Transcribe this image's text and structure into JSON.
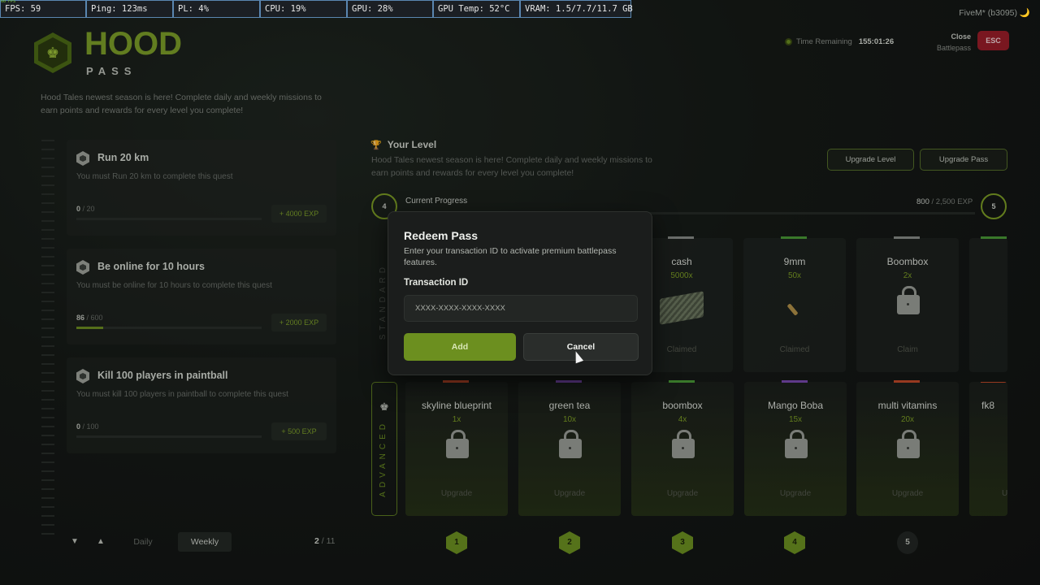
{
  "overlay": {
    "fps_tiny": "60 FPS",
    "cells": [
      "FPS: 59",
      "Ping: 123ms",
      "PL: 4%",
      "CPU: 19%",
      "GPU: 28%",
      "GPU Temp: 52°C",
      "VRAM: 1.5/7.7/11.7 GB"
    ],
    "client": "FiveM* (b3095) 🌙"
  },
  "header": {
    "title": "HOOD",
    "subtitle": "PASS",
    "intro": "Hood Tales newest season is here! Complete daily and weekly missions to earn points and rewards for every level you complete!",
    "time_label": "Time Remaining",
    "time_value": "155:01:26",
    "close_line1": "Close",
    "close_line2": "Battlepass",
    "esc": "ESC"
  },
  "quests": [
    {
      "title": "Run 20 km",
      "desc": "You must Run 20 km to complete this quest",
      "current": "0",
      "total": " / 20",
      "progress": 0,
      "exp": "+ 4000 EXP"
    },
    {
      "title": "Be online for 10 hours",
      "desc": "You must be online for 10 hours to complete this quest",
      "current": "86",
      "total": " / 600",
      "progress": 0.143,
      "exp": "+ 2000 EXP"
    },
    {
      "title": "Kill 100 players in paintball",
      "desc": "You must kill 100 players in paintball to complete this quest",
      "current": "0",
      "total": " / 100",
      "progress": 0,
      "exp": "+ 500 EXP"
    }
  ],
  "quest_nav": {
    "daily": "Daily",
    "weekly": "Weekly",
    "page_current": "2",
    "page_total": " / 11"
  },
  "level": {
    "title": "Your Level",
    "desc": "Hood Tales newest season is here! Complete daily and weekly missions to earn points and rewards for every level you complete!",
    "upgrade_level": "Upgrade Level",
    "upgrade_pass": "Upgrade Pass",
    "current_level": "4",
    "next_level": "5",
    "progress_label": "Current Progress",
    "exp_current": "800",
    "exp_total": " / 2,500 EXP",
    "progress_fraction": 0.32
  },
  "tracks": {
    "standard": "STANDARD",
    "advanced": "ADVANCED"
  },
  "standard_rewards": [
    {
      "name": "cash",
      "qty": "5000x",
      "status": "Claimed",
      "stripe": "#8a8d89",
      "icon": "cash-icon"
    },
    {
      "name": "9mm",
      "qty": "50x",
      "status": "Claimed",
      "stripe": "#4a9a36",
      "icon": "ammo-icon"
    },
    {
      "name": "Boombox",
      "qty": "2x",
      "status": "Claim",
      "stripe": "#8a8d89",
      "icon": "lock-icon"
    }
  ],
  "advanced_rewards": [
    {
      "name": "skyline blueprint",
      "qty": "1x",
      "status": "Upgrade",
      "stripe": "#c24a2a"
    },
    {
      "name": "green tea",
      "qty": "10x",
      "status": "Upgrade",
      "stripe": "#7a4ab0"
    },
    {
      "name": "boombox",
      "qty": "4x",
      "status": "Upgrade",
      "stripe": "#4a9a36"
    },
    {
      "name": "Mango Boba",
      "qty": "15x",
      "status": "Upgrade",
      "stripe": "#7a4ab0"
    },
    {
      "name": "multi vitamins",
      "qty": "20x",
      "status": "Upgrade",
      "stripe": "#c24a2a"
    },
    {
      "name": "fk8",
      "qty": "",
      "status": "U",
      "stripe": "#c24a2a"
    }
  ],
  "level_markers": [
    "1",
    "2",
    "3",
    "4",
    "5"
  ],
  "modal": {
    "title": "Redeem Pass",
    "desc": "Enter your transaction ID to activate premium battlepass features.",
    "label": "Transaction ID",
    "placeholder": "XXXX-XXXX-XXXX-XXXX",
    "add": "Add",
    "cancel": "Cancel"
  },
  "colors": {
    "accent": "#7ea02a",
    "danger": "#9b1e2a",
    "background": "#151816"
  }
}
